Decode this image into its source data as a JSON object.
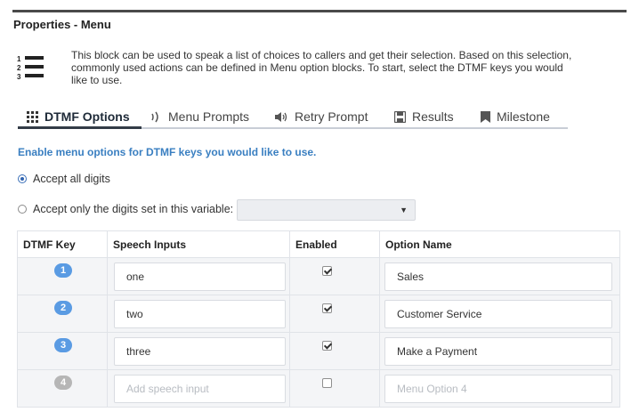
{
  "panel": {
    "title": "Properties - Menu",
    "description": "This block can be used to speak a list of choices to callers and get their selection. Based on this selection, commonly used actions can be defined in Menu option blocks. To start, select the DTMF keys you would like to use.",
    "list_icon_numbers": [
      "1",
      "2",
      "3"
    ]
  },
  "tabs": [
    {
      "label": "DTMF Options",
      "icon": "grid-icon",
      "active": true
    },
    {
      "label": "Menu Prompts",
      "icon": "speaker-waves-icon",
      "active": false
    },
    {
      "label": "Retry Prompt",
      "icon": "speaker-icon",
      "active": false
    },
    {
      "label": "Results",
      "icon": "save-icon",
      "active": false
    },
    {
      "label": "Milestone",
      "icon": "bookmark-icon",
      "active": false
    }
  ],
  "dtmf": {
    "enable_text": "Enable menu options for DTMF keys you would like to use.",
    "radio_all": "Accept all digits",
    "radio_variable": "Accept only the digits set in this variable:",
    "selected_radio": "all",
    "variable_value": ""
  },
  "table": {
    "headers": [
      "DTMF Key",
      "Speech Inputs",
      "Enabled",
      "Option Name"
    ],
    "rows": [
      {
        "key": "1",
        "speech": "one",
        "enabled": true,
        "option": "Sales"
      },
      {
        "key": "2",
        "speech": "two",
        "enabled": true,
        "option": "Customer Service"
      },
      {
        "key": "3",
        "speech": "three",
        "enabled": true,
        "option": "Make a Payment"
      },
      {
        "key": "4",
        "speech_placeholder": "Add speech input",
        "enabled": false,
        "option_placeholder": "Menu Option 4"
      }
    ]
  },
  "colors": {
    "accent": "#3a7fc1",
    "key_badge": "#5a9be3",
    "key_badge_disabled": "#b6b6b6",
    "active_tab_underline": "#333c47"
  }
}
